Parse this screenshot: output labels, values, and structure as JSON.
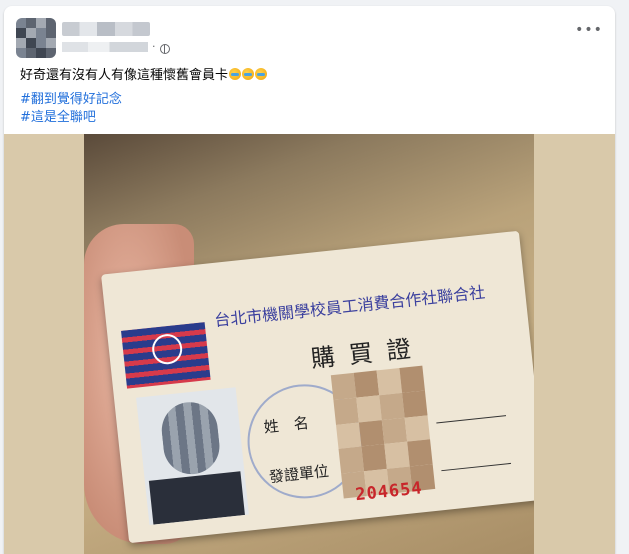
{
  "post": {
    "text": "好奇還有沒有人有像這種懷舊會員卡",
    "emoji_count": 3,
    "hashtags": [
      "#翻到覺得好記念",
      "#這是全聯吧"
    ],
    "more_label": "•••",
    "separator": "·"
  },
  "card": {
    "org_name": "台北市機關學校員工消費合作社聯合社",
    "title": "購買證",
    "name_label": "姓　名",
    "issuer_label": "發證單位",
    "serial": "204654"
  }
}
